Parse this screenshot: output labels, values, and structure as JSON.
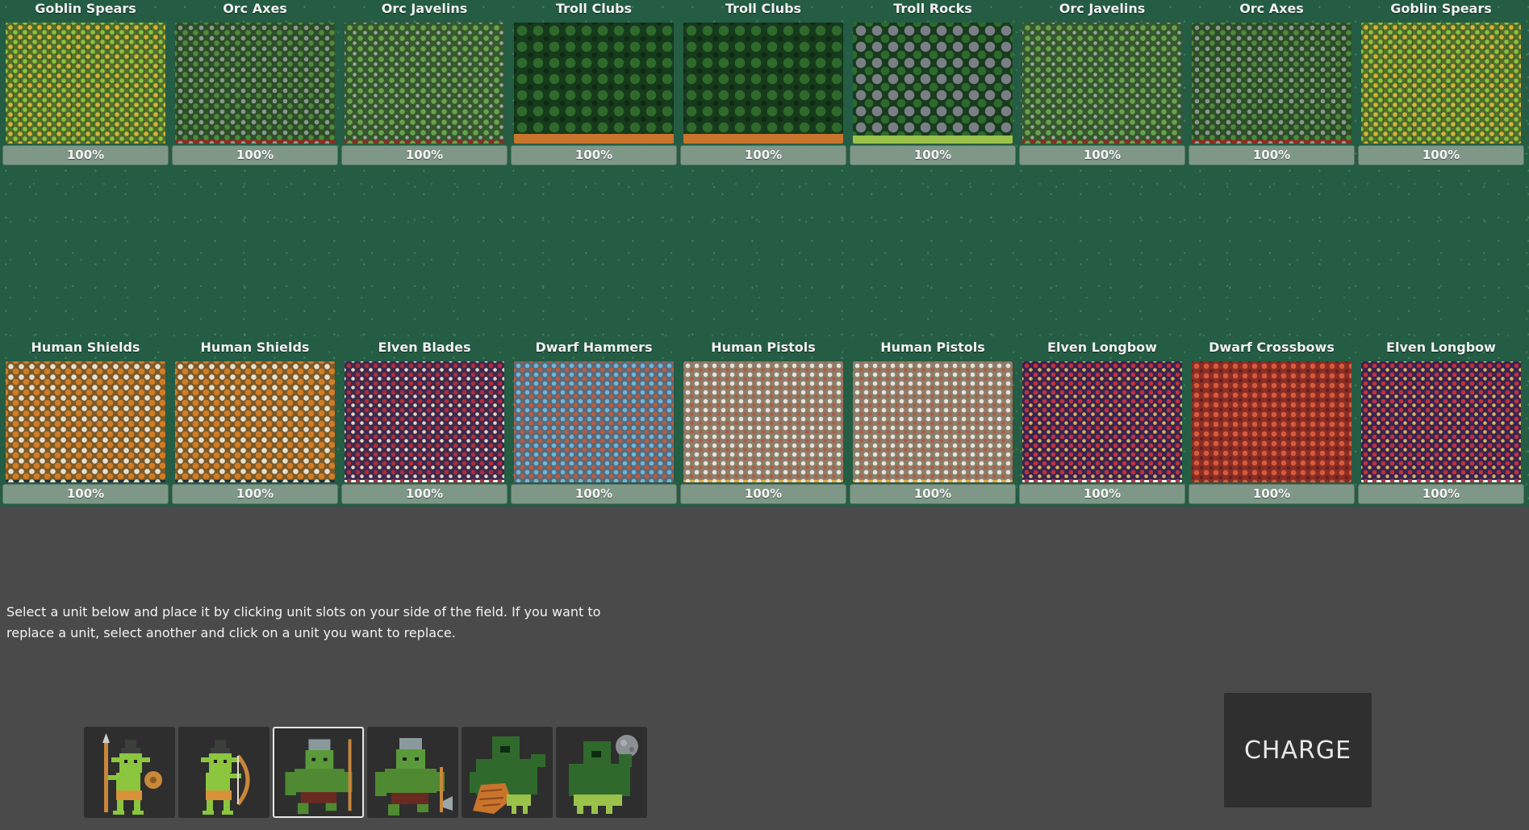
{
  "enemy_units": [
    {
      "name": "Goblin Spears",
      "health": "100%",
      "formation": "goblin-spears"
    },
    {
      "name": "Orc Axes",
      "health": "100%",
      "formation": "orc-axes"
    },
    {
      "name": "Orc Javelins",
      "health": "100%",
      "formation": "orc-javelins"
    },
    {
      "name": "Troll Clubs",
      "health": "100%",
      "formation": "troll-clubs"
    },
    {
      "name": "Troll Clubs",
      "health": "100%",
      "formation": "troll-clubs"
    },
    {
      "name": "Troll Rocks",
      "health": "100%",
      "formation": "troll-rocks"
    },
    {
      "name": "Orc Javelins",
      "health": "100%",
      "formation": "orc-javelins"
    },
    {
      "name": "Orc Axes",
      "health": "100%",
      "formation": "orc-axes"
    },
    {
      "name": "Goblin Spears",
      "health": "100%",
      "formation": "goblin-spears"
    }
  ],
  "player_units": [
    {
      "name": "Human Shields",
      "health": "100%",
      "formation": "human-shields"
    },
    {
      "name": "Human Shields",
      "health": "100%",
      "formation": "human-shields"
    },
    {
      "name": "Elven Blades",
      "health": "100%",
      "formation": "elven-blades"
    },
    {
      "name": "Dwarf Hammers",
      "health": "100%",
      "formation": "dwarf-hammers"
    },
    {
      "name": "Human Pistols",
      "health": "100%",
      "formation": "human-pistols"
    },
    {
      "name": "Human Pistols",
      "health": "100%",
      "formation": "human-pistols"
    },
    {
      "name": "Elven Longbow",
      "health": "100%",
      "formation": "elven-longbow"
    },
    {
      "name": "Dwarf Crossbows",
      "health": "100%",
      "formation": "dwarf-crossbows"
    },
    {
      "name": "Elven Longbow",
      "health": "100%",
      "formation": "elven-longbow"
    }
  ],
  "instructions": "Select a unit below and place it by clicking unit slots on your side of the field. If you want to replace a unit, select another and click on a unit you want to replace.",
  "unit_selector": [
    {
      "icon": "goblin-spear-icon",
      "selected": false
    },
    {
      "icon": "goblin-archer-icon",
      "selected": false
    },
    {
      "icon": "orc-javelin-icon",
      "selected": true
    },
    {
      "icon": "orc-axe-icon",
      "selected": false
    },
    {
      "icon": "troll-club-icon",
      "selected": false
    },
    {
      "icon": "troll-rock-icon",
      "selected": false
    }
  ],
  "charge_button": {
    "label": "CHARGE"
  },
  "colors": {
    "field": "#245c44",
    "panel": "#4a4a4a",
    "health_bar": "#7f9787",
    "button": "#2f2f2f"
  }
}
